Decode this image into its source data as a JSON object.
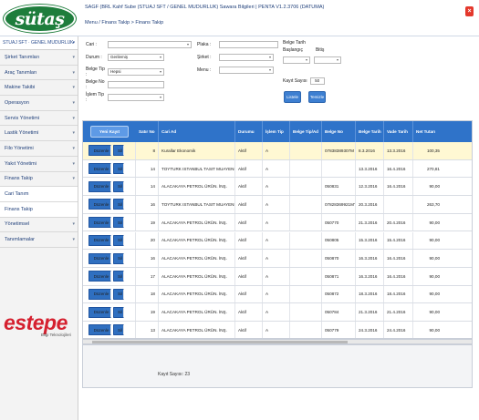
{
  "header": {
    "logo_text": "sütaş",
    "title": "SAGF (BRL Kahf Sube (STUAJ SFT / GENEL MUDURLUK)    Sawara Bilgileri | PENTA V1.2.3706 (DATUMA)",
    "breadcrumb": "Menu / Finans Takip > Finans Takip",
    "close_label": "×"
  },
  "sidebar": {
    "user": "STUAJ SFT · GENEL MUDURLUK",
    "items": [
      {
        "label": "Şirket Tanımları",
        "arrow": "▾"
      },
      {
        "label": "Araç Tanımları",
        "arrow": "▾"
      },
      {
        "label": "Makine Takibi",
        "arrow": "▾"
      },
      {
        "label": "Operasyon",
        "arrow": "▾"
      },
      {
        "label": "Servis Yönetimi",
        "arrow": "▾"
      },
      {
        "label": "Lastik Yönetimi",
        "arrow": "▾"
      },
      {
        "label": "Filo Yönetimi",
        "arrow": "▾"
      },
      {
        "label": "Yakıt Yönetimi",
        "arrow": "▾"
      },
      {
        "label": "Finans Takip",
        "arrow": "▾"
      },
      {
        "label": "Cari Tanım",
        "arrow": ""
      },
      {
        "label": "Finans Takip",
        "arrow": ""
      },
      {
        "label": "Yönetimsel",
        "arrow": "▾"
      },
      {
        "label": "Tanımlamalar",
        "arrow": "▾"
      }
    ],
    "partner_logo": "estepe",
    "partner_sub": "Bilgi Teknolojileri"
  },
  "filters": {
    "cari_label": "Cari :",
    "durum_label": "Durum :",
    "durum_value": "Gerilemiş",
    "belge_tip_label": "Belge Tip :",
    "belge_tip_value": "Hepsi",
    "belge_no_label": "Belge No :",
    "islem_tip_label": "İşlem Tip :",
    "plaka_label": "Plaka :",
    "sirket_label": "Şirket :",
    "menu_label": "Menu :",
    "belge_tarih_label": "Belge Tarih",
    "baslangic_label": "Başlangıç",
    "bitis_label": "Bitiş",
    "kayit_sayisi_label": "Kayıt Sayısı",
    "kayit_sayisi_value": "50",
    "listele_label": "Listele",
    "temizle_label": "Temizle"
  },
  "grid": {
    "columns": [
      "Yeni Kayıt",
      "Satır No",
      "Cari Ad",
      "Durumu",
      "İşlem Tip",
      "Belge Tip/Ad",
      "Belge No",
      "Belge Tarih",
      "Vade Tarih",
      "Net Tutarı"
    ],
    "edit_label": "Düzenle",
    "delete_label": "Sil",
    "rows": [
      {
        "no": "8",
        "cari": "Kurallar Ekonomik",
        "durum": "Aktif",
        "islem": "A",
        "belgetip": "",
        "belgeno": "07838389307M",
        "tarih": "8.3.2016",
        "vade": "13.3.2016",
        "tutar": "100,35",
        "highlight": true
      },
      {
        "no": "14",
        "cari": "TOYTURK ISTANBUL TASIT MUAYENE",
        "durum": "Aktif",
        "islem": "A",
        "belgetip": "",
        "belgeno": "",
        "tarih": "13.3.2016",
        "vade": "16.4.2016",
        "tutar": "270,81",
        "highlight": false
      },
      {
        "no": "14",
        "cari": "ALACAKAYA PETROL ÜRÜN. İNŞ.",
        "durum": "Aktif",
        "islem": "A",
        "belgetip": "",
        "belgeno": "050831",
        "tarih": "12.3.2016",
        "vade": "16.4.2016",
        "tutar": "90,00",
        "highlight": false
      },
      {
        "no": "16",
        "cari": "TOYTURK ISTANBUL TASIT MUAYENE A.",
        "durum": "Aktif",
        "islem": "A",
        "belgetip": "",
        "belgeno": "07828369921MT",
        "tarih": "20.3.2016",
        "vade": "",
        "tutar": "263,70",
        "highlight": false
      },
      {
        "no": "19",
        "cari": "ALACAKAYA PETROL ÜRÜN. İNŞ.",
        "durum": "Aktif",
        "islem": "A",
        "belgetip": "",
        "belgeno": "050770",
        "tarih": "21.3.2016",
        "vade": "20.4.2016",
        "tutar": "90,00",
        "highlight": false
      },
      {
        "no": "20",
        "cari": "ALACAKAYA PETROL ÜRÜN. İNŞ.",
        "durum": "Aktif",
        "islem": "A",
        "belgetip": "",
        "belgeno": "050805",
        "tarih": "15.3.2016",
        "vade": "15.4.2016",
        "tutar": "90,00",
        "highlight": false
      },
      {
        "no": "16",
        "cari": "ALACAKAYA PETROL ÜRÜN. İNŞ.",
        "durum": "Aktif",
        "islem": "A",
        "belgetip": "",
        "belgeno": "050870",
        "tarih": "16.3.2016",
        "vade": "16.4.2016",
        "tutar": "90,00",
        "highlight": false
      },
      {
        "no": "17",
        "cari": "ALACAKAYA PETROL ÜRÜN. İNŞ.",
        "durum": "Aktif",
        "islem": "A",
        "belgetip": "",
        "belgeno": "050871",
        "tarih": "16.3.2016",
        "vade": "16.4.2016",
        "tutar": "90,00",
        "highlight": false
      },
      {
        "no": "18",
        "cari": "ALACAKAYA PETROL ÜRÜN. İNŞ.",
        "durum": "Aktif",
        "islem": "A",
        "belgetip": "",
        "belgeno": "050872",
        "tarih": "18.3.2016",
        "vade": "18.4.2016",
        "tutar": "90,00",
        "highlight": false
      },
      {
        "no": "19",
        "cari": "ALACAKAYA PETROL ÜRÜN. İNŞ.",
        "durum": "Aktif",
        "islem": "A",
        "belgetip": "",
        "belgeno": "050784",
        "tarih": "21.3.2016",
        "vade": "21.4.2016",
        "tutar": "90,00",
        "highlight": false
      },
      {
        "no": "13",
        "cari": "ALACAKAYA PETROL ÜRÜN. İNŞ.",
        "durum": "Aktif",
        "islem": "A",
        "belgetip": "",
        "belgeno": "050779",
        "tarih": "24.3.2016",
        "vade": "24.4.2016",
        "tutar": "90,00",
        "highlight": false
      }
    ],
    "footer_label": "Kayıt Sayısı: 23"
  },
  "colors": {
    "brand_green": "#1e7d3c",
    "grid_header": "#2f73c9",
    "button_blue": "#2f6fc0",
    "highlight_row": "#fff8d3",
    "estepe_red": "#d5202f"
  }
}
